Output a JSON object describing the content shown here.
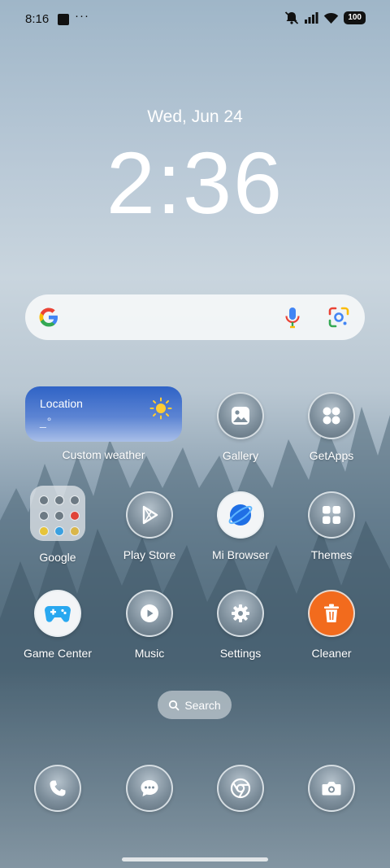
{
  "status_bar": {
    "time": "8:16",
    "dots": "···",
    "battery": "100",
    "icons": [
      "notification-square-icon",
      "muted-bell-icon",
      "signal-icon",
      "wifi-icon",
      "battery-icon"
    ]
  },
  "lockclock": {
    "date": "Wed, Jun 24",
    "time": "2:36"
  },
  "search_bar": {
    "icons": [
      "google-logo-icon",
      "microphone-icon",
      "google-lens-icon"
    ]
  },
  "weather_widget": {
    "location": "Location",
    "temp": "_°",
    "label": "Custom weather",
    "icon": "sun-icon"
  },
  "apps": {
    "row1": [
      {
        "label": "Gallery",
        "icon": "gallery-icon"
      },
      {
        "label": "GetApps",
        "icon": "getapps-icon"
      }
    ],
    "row2": [
      {
        "label": "Google",
        "icon": "folder-icon"
      },
      {
        "label": "Play Store",
        "icon": "play-store-icon"
      },
      {
        "label": "Mi Browser",
        "icon": "mi-browser-icon"
      },
      {
        "label": "Themes",
        "icon": "themes-icon"
      }
    ],
    "row3": [
      {
        "label": "Game Center",
        "icon": "game-center-icon"
      },
      {
        "label": "Music",
        "icon": "music-icon"
      },
      {
        "label": "Settings",
        "icon": "settings-icon"
      },
      {
        "label": "Cleaner",
        "icon": "cleaner-icon"
      }
    ]
  },
  "home_search": {
    "label": "Search",
    "icon": "magnifier-icon"
  },
  "dock": [
    "phone-icon",
    "messages-icon",
    "chrome-icon",
    "camera-icon"
  ],
  "colors": {
    "weather_gradient_top": "#2f63c6",
    "cleaner_orange": "#f26b1d",
    "game_center_blue": "#29a8f0",
    "browser_blue": "#1f6fe5"
  }
}
